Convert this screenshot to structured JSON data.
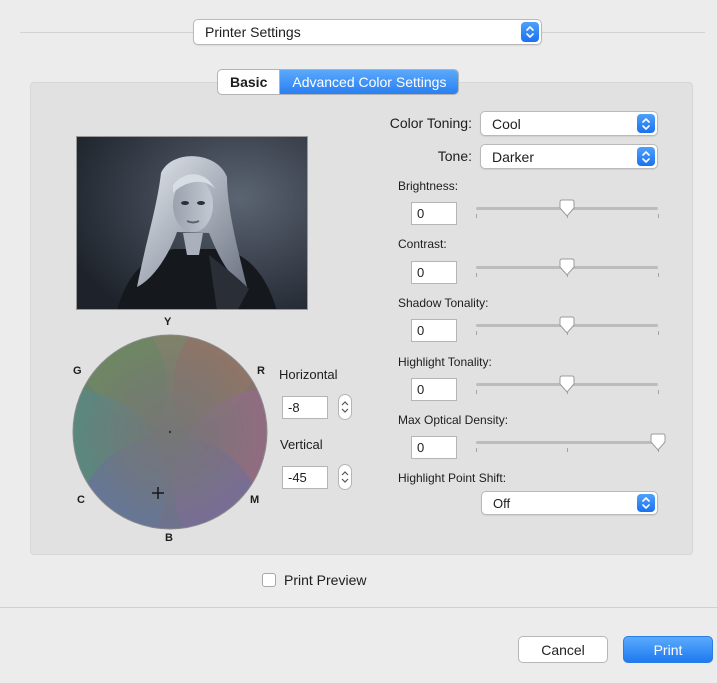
{
  "header": {
    "preset_popup": "Printer Settings"
  },
  "tabs": [
    {
      "label": "Basic",
      "active": false
    },
    {
      "label": "Advanced Color Settings",
      "active": true
    }
  ],
  "color_wheel": {
    "axis_labels": {
      "top": "Y",
      "left": "G",
      "right": "R",
      "bottom_left": "C",
      "bottom_right": "M",
      "bottom": "B"
    },
    "horizontal_label": "Horizontal",
    "horizontal_value": "-8",
    "vertical_label": "Vertical",
    "vertical_value": "-45"
  },
  "settings": {
    "color_toning_label": "Color Toning:",
    "color_toning_value": "Cool",
    "tone_label": "Tone:",
    "tone_value": "Darker",
    "brightness_label": "Brightness:",
    "brightness_value": "0",
    "contrast_label": "Contrast:",
    "contrast_value": "0",
    "shadow_tonality_label": "Shadow Tonality:",
    "shadow_tonality_value": "0",
    "highlight_tonality_label": "Highlight Tonality:",
    "highlight_tonality_value": "0",
    "max_optical_density_label": "Max Optical Density:",
    "max_optical_density_value": "0",
    "highlight_point_shift_label": "Highlight Point Shift:",
    "highlight_point_shift_value": "Off"
  },
  "slider_levels": {
    "brightness": 0.5,
    "contrast": 0.5,
    "shadow_tonality": 0.5,
    "highlight_tonality": 0.5,
    "max_optical_density": 1.0
  },
  "footer": {
    "print_preview_label": "Print Preview",
    "cancel_label": "Cancel",
    "print_label": "Print"
  },
  "colors": {
    "accent": "#2a7ff2",
    "panel_bg": "#e1e1e1",
    "window_bg": "#ececec"
  }
}
